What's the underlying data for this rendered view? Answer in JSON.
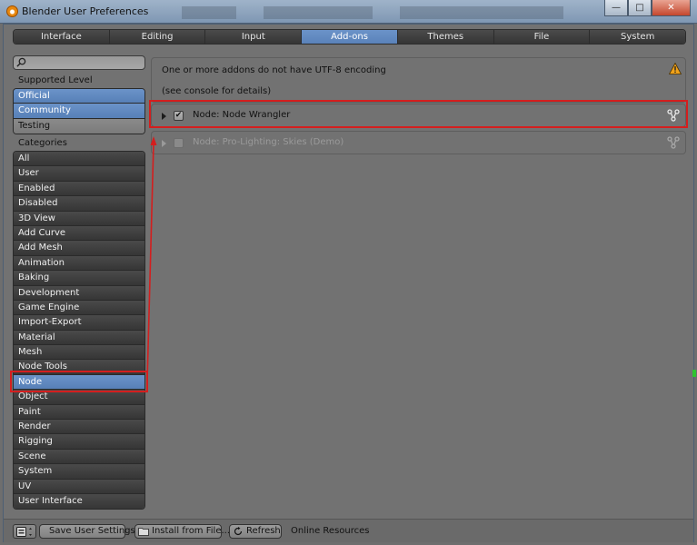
{
  "window": {
    "title": "Blender User Preferences",
    "controls": [
      "minimize",
      "maximize",
      "close"
    ]
  },
  "tabs": [
    {
      "label": "Interface",
      "active": false
    },
    {
      "label": "Editing",
      "active": false
    },
    {
      "label": "Input",
      "active": false
    },
    {
      "label": "Add-ons",
      "active": true
    },
    {
      "label": "Themes",
      "active": false
    },
    {
      "label": "File",
      "active": false
    },
    {
      "label": "System",
      "active": false
    }
  ],
  "sidebar": {
    "search_placeholder": "",
    "supported_level_label": "Supported Level",
    "supported_levels": [
      {
        "label": "Official",
        "selected": true
      },
      {
        "label": "Community",
        "selected": true
      },
      {
        "label": "Testing",
        "selected": false
      }
    ],
    "categories_label": "Categories",
    "categories": [
      {
        "label": "All"
      },
      {
        "label": "User"
      },
      {
        "label": "Enabled"
      },
      {
        "label": "Disabled"
      },
      {
        "label": "3D View"
      },
      {
        "label": "Add Curve"
      },
      {
        "label": "Add Mesh"
      },
      {
        "label": "Animation"
      },
      {
        "label": "Baking"
      },
      {
        "label": "Development"
      },
      {
        "label": "Game Engine"
      },
      {
        "label": "Import-Export"
      },
      {
        "label": "Material"
      },
      {
        "label": "Mesh"
      },
      {
        "label": "Node Tools"
      },
      {
        "label": "Node",
        "selected": true
      },
      {
        "label": "Object"
      },
      {
        "label": "Paint"
      },
      {
        "label": "Render"
      },
      {
        "label": "Rigging"
      },
      {
        "label": "Scene"
      },
      {
        "label": "System"
      },
      {
        "label": "UV"
      },
      {
        "label": "User Interface"
      }
    ]
  },
  "main": {
    "warning_line1": "One or more addons do not have UTF-8 encoding",
    "warning_line2": "(see console for details)",
    "warning_icon": "warning-triangle-icon",
    "addons": [
      {
        "name": "Node: Node Wrangler",
        "enabled": true,
        "check_glyph": "✔"
      },
      {
        "name": "Node: Pro-Lighting: Skies (Demo)",
        "enabled": false,
        "check_glyph": ""
      }
    ]
  },
  "bottombar": {
    "editor_type_icon": "preferences-editor-icon",
    "save_label": "Save User Settings",
    "install_label": "Install from File...",
    "refresh_label": "Refresh",
    "online_label": "Online Resources"
  },
  "colors": {
    "accent": "#5a82b9",
    "highlight_annotation": "#d41e1e"
  }
}
